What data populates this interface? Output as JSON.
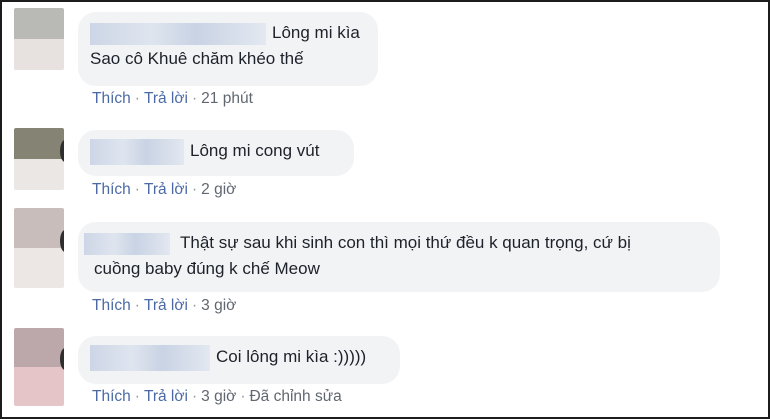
{
  "comments": [
    {
      "text_lines": [
        "Lông mi kìa",
        "Sao cô Khuê chăm khéo thế"
      ],
      "like": "Thích",
      "reply": "Trả lời",
      "time": "21 phút",
      "edited": ""
    },
    {
      "text_lines": [
        "Lông mi cong vút"
      ],
      "like": "Thích",
      "reply": "Trả lời",
      "time": "2 giờ",
      "edited": ""
    },
    {
      "text_lines": [
        "Thật sự sau khi sinh con thì mọi thứ đều k quan trọng, cứ bị",
        "cuồng baby đúng k chế Meow"
      ],
      "like": "Thích",
      "reply": "Trả lời",
      "time": "3 giờ",
      "edited": ""
    },
    {
      "text_lines": [
        "Coi lông mi kìa :)))))"
      ],
      "like": "Thích",
      "reply": "Trả lời",
      "time": "3 giờ",
      "edited": "Đã chỉnh sửa"
    }
  ],
  "colors": {
    "bubble_bg": "#f2f3f5",
    "text": "#1d2129",
    "action_link": "#4b6aa5",
    "redacted_name": "#cdd6e6"
  }
}
